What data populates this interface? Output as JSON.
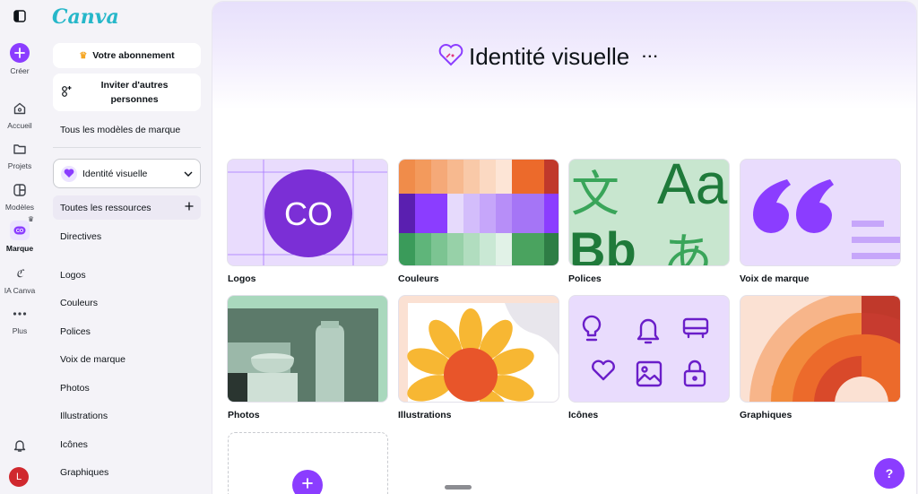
{
  "app": {
    "logo": "Canva"
  },
  "rail": {
    "create": "Créer",
    "home": "Accueil",
    "projects": "Projets",
    "templates": "Modèles",
    "brand": "Marque",
    "ai": "IA Canva",
    "more": "Plus",
    "user_initial": "L"
  },
  "panel": {
    "subscription": "Votre abonnement",
    "invite": "Inviter d'autres personnes",
    "all_templates": "Tous les modèles de marque",
    "brand_kit": "Identité visuelle",
    "all_resources": "Toutes les ressources",
    "guidelines": "Directives",
    "items": [
      "Logos",
      "Couleurs",
      "Polices",
      "Voix de marque",
      "Photos",
      "Illustrations",
      "Icônes",
      "Graphiques"
    ]
  },
  "main": {
    "title": "Identité visuelle",
    "more": "···",
    "tiles": [
      {
        "label": "Logos",
        "thumb_text": "CO"
      },
      {
        "label": "Couleurs"
      },
      {
        "label": "Polices",
        "thumb_text_1": "文",
        "thumb_text_2": "Aa",
        "thumb_text_3": "Bb",
        "thumb_text_4": "あ"
      },
      {
        "label": "Voix de marque"
      },
      {
        "label": "Photos"
      },
      {
        "label": "Illustrations"
      },
      {
        "label": "Icônes"
      },
      {
        "label": "Graphiques"
      }
    ]
  },
  "help": "?",
  "colors": {
    "accent": "#8b3dff",
    "brand_text": "#26b7c9"
  }
}
